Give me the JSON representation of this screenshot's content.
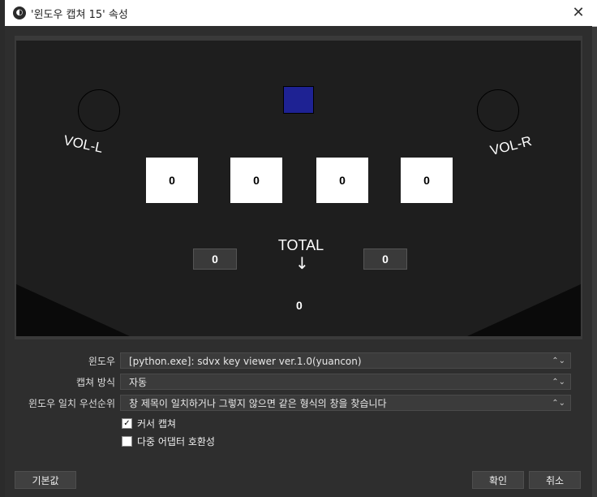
{
  "window": {
    "title": "'윈도우 캡쳐 15' 속성",
    "close_glyph": "✕",
    "logo_glyph": "◐"
  },
  "preview": {
    "vol_left": "VOL-L",
    "vol_right": "VOL-R",
    "bt_keys": [
      "0",
      "0",
      "0",
      "0"
    ],
    "fx_left": "0",
    "fx_right": "0",
    "total_label": "TOTAL",
    "total_arrow": "↓",
    "total_value": "0",
    "fx_square_color": "#1e2293"
  },
  "form": {
    "window_label": "윈도우",
    "window_value": "[python.exe]: sdvx key viewer ver.1.0(yuancon)",
    "capture_method_label": "캡쳐 방식",
    "capture_method_value": "자동",
    "priority_label": "윈도우 일치 우선순위",
    "priority_value": "창 제목이 일치하거나 그렇지 않으면 같은 형식의 창을 찾습니다",
    "capture_cursor_label": "커서 캡쳐",
    "capture_cursor_checked": true,
    "multi_adapter_label": "다중 어댑터 호환성",
    "multi_adapter_checked": false,
    "chevron": "⌃⌄"
  },
  "buttons": {
    "defaults": "기본값",
    "ok": "확인",
    "cancel": "취소"
  },
  "colors": {
    "dialog_bg": "#2e2e2e",
    "preview_bg": "#1e1e1e",
    "key_box": "#ffffff"
  }
}
